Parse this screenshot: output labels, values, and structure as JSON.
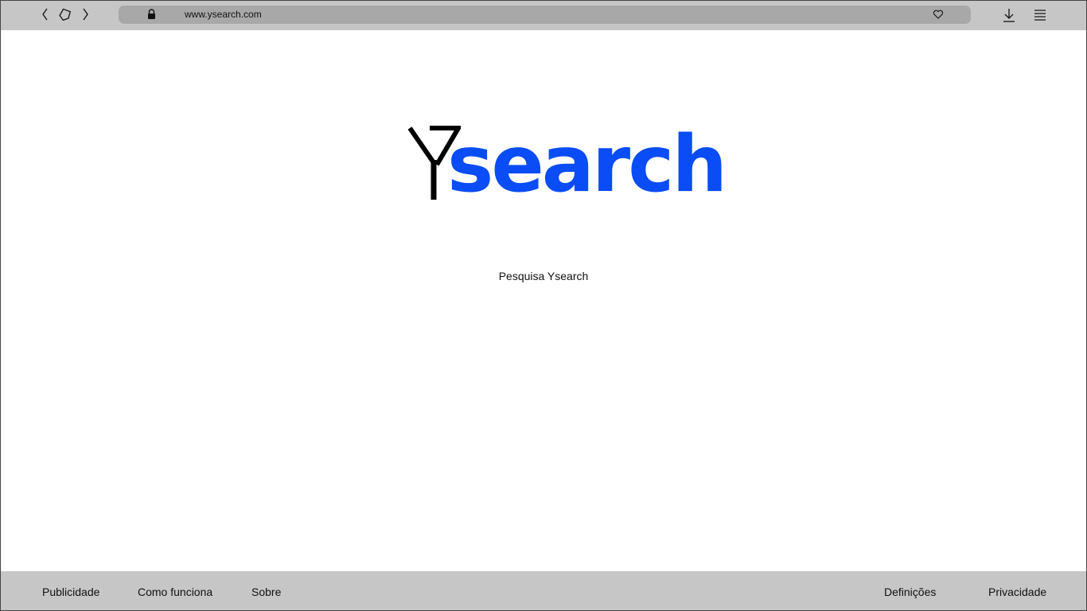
{
  "browser": {
    "url": "www.ysearch.com",
    "icons": {
      "back": "chevron-left-icon",
      "home": "home-icon",
      "forward": "chevron-right-icon",
      "lock": "lock-icon",
      "favorite": "heart-icon",
      "download": "download-icon",
      "menu": "hamburger-menu-icon"
    }
  },
  "logo": {
    "letter_mark": "Y",
    "word": "search",
    "colors": {
      "mark": "#000000",
      "word": "#0a4cf5"
    }
  },
  "main": {
    "search_link": "Pesquisa Ysearch"
  },
  "footer": {
    "left_links": [
      "Publicidade",
      "Como funciona",
      "Sobre"
    ],
    "right_links": [
      "Definições",
      "Privacidade"
    ]
  },
  "colors": {
    "chrome": "#c6c6c6",
    "urlbar": "#a8a8a8",
    "page_bg": "#ffffff"
  }
}
